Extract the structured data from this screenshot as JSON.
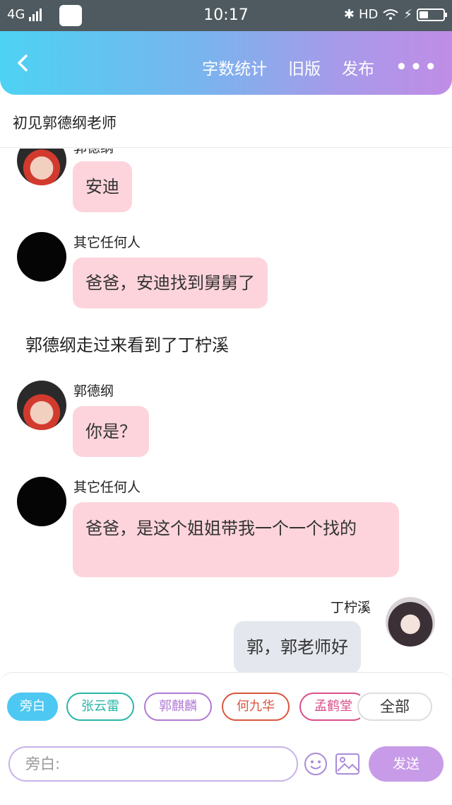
{
  "status_bar": {
    "network": "4G",
    "time": "10:17",
    "hd": "HD"
  },
  "navbar": {
    "word_count": "字数统计",
    "old_version": "旧版",
    "publish": "发布",
    "more": "•••"
  },
  "document": {
    "title": "初见郭德纲老师"
  },
  "chat": {
    "partial_speaker": "郭德纲",
    "messages": [
      {
        "speaker": "",
        "text": "安迪"
      },
      {
        "speaker": "其它任何人",
        "text": "爸爸，安迪找到舅舅了"
      },
      {
        "narration": "郭德纲走过来看到了丁柠溪"
      },
      {
        "speaker": "郭德纲",
        "text": "你是？"
      },
      {
        "speaker": "其它任何人",
        "text": "爸爸，是这个姐姐带我一个一个找的"
      },
      {
        "speaker": "丁柠溪",
        "text": "郭，郭老师好"
      }
    ]
  },
  "roles": {
    "chips": [
      {
        "label": "旁白",
        "color": "#4dc8f2"
      },
      {
        "label": "张云雷",
        "color": "#2bb6a8"
      },
      {
        "label": "郭麒麟",
        "color": "#b07ad4"
      },
      {
        "label": "何九华",
        "color": "#d9573f"
      },
      {
        "label": "孟鹤堂",
        "color": "#d94f8a"
      }
    ],
    "all": "全部"
  },
  "composer": {
    "placeholder": "旁白:",
    "send": "发送"
  },
  "colors": {
    "header_gradient_start": "#4dd2f3",
    "header_gradient_end": "#c08de6",
    "bubble_left": "#fdd4dc",
    "bubble_right": "#e4e8ee",
    "send_button": "#c89be8"
  }
}
